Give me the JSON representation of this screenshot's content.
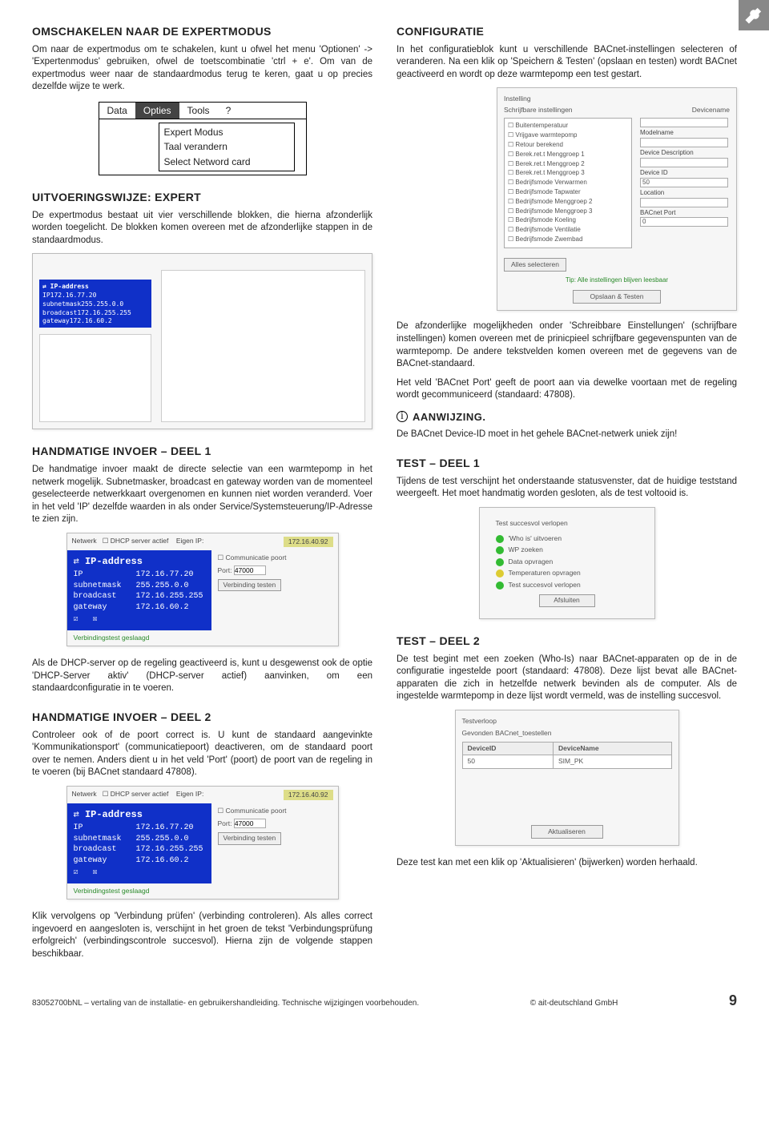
{
  "page_icon": "wrench-icon",
  "left": {
    "h_omschakelen": "OMSCHAKELEN NAAR DE EXPERTMODUS",
    "p_omschakelen_1": "Om naar de expertmodus om te schakelen, kunt u ofwel het menu 'Optionen' -> 'Expertenmodus' gebruiken, ofwel de toetscombinatie 'ctrl + e'. Om van de expertmodus weer naar de standaardmodus terug te keren, gaat u op precies dezelfde wijze te werk.",
    "menu": {
      "items": [
        "Data",
        "Opties",
        "Tools",
        "?"
      ],
      "dropdown": [
        "Expert Modus",
        "Taal verandern",
        "Select Netword card"
      ]
    },
    "h_uitvoering": "UITVOERINGSWIJZE: EXPERT",
    "p_uitvoering": "De expertmodus bestaat uit vier verschillende blokken, die hierna afzonderlijk worden toegelicht. De blokken komen overeen met de afzonderlijke stappen in de standaardmodus.",
    "ss_big_blue": {
      "title": "IP-address",
      "rows": [
        [
          "IP",
          "172.16.77.20"
        ],
        [
          "subnetmask",
          "255.255.0.0"
        ],
        [
          "broadcast",
          "172.16.255.255"
        ],
        [
          "gateway",
          "172.16.60.2"
        ]
      ]
    },
    "h_hand1": "HANDMATIGE INVOER – DEEL 1",
    "p_hand1": "De handmatige invoer maakt de directe selectie van een warmtepomp in het netwerk mogelijk. Subnetmasker, broadcast en gateway worden van de momenteel geselecteerde netwerkkaart overgenomen en kunnen niet worden veranderd. Voer in het veld 'IP' dezelfde waarden in als onder Service/Systemsteuerung/IP-Adresse te zien zijn.",
    "ss_net": {
      "group": "Netwerk",
      "dhcp": "DHCP server actief",
      "eigen": "Eigen IP:",
      "eigen_ip": "172.16.40.92",
      "comm": "Communicatie poort",
      "port_label": "Port:",
      "port_value": "47000",
      "btn_test": "Verbinding testen",
      "status": "Verbindingstest geslaagd",
      "blue": {
        "title": "IP-address",
        "rows": [
          [
            "IP",
            "172.16.77.20"
          ],
          [
            "subnetmask",
            "255.255.0.0"
          ],
          [
            "broadcast",
            "172.16.255.255"
          ],
          [
            "gateway",
            "172.16.60.2"
          ]
        ]
      }
    },
    "p_hand1_after": "Als de DHCP-server op de regeling geactiveerd is, kunt u desgewenst ook de optie 'DHCP-Server aktiv' (DHCP-server actief) aanvinken, om een standaardconfiguratie in te voeren.",
    "h_hand2": "HANDMATIGE INVOER – DEEL 2",
    "p_hand2": "Controleer ook of de poort correct is. U kunt de standaard aangevinkte 'Kommunikationsport' (communicatiepoort) deactiveren, om de standaard poort over te nemen. Anders dient u in het veld 'Port' (poort) de poort van de regeling in te voeren (bij BACnet standaard 47808).",
    "p_hand2_after": "Klik vervolgens op 'Verbindung prüfen' (verbinding controleren). Als alles correct ingevoerd en aangesloten is, verschijnt in het groen de tekst 'Verbindungsprüfung erfolgreich' (verbindingscontrole succesvol). Hierna zijn de volgende stappen beschikbaar."
  },
  "right": {
    "h_config": "CONFIGURATIE",
    "p_config": "In het configuratieblok kunt u verschillende BACnet-instellingen selecteren of veranderen. Na een klik op 'Speichern & Testen' (opslaan en testen) wordt BACnet geactiveerd en wordt op deze warmtepomp een test gestart.",
    "ss_config": {
      "title": "Instelling",
      "sub": "Schrijfbare instellingen",
      "list": [
        "Buitentemperatuur",
        "Vrijgave warmtepomp",
        "Retour berekend",
        "Berek.ret.t Menggroep 1",
        "Berek.ret.t Menggroep 2",
        "Berek.ret.t Menggroep 3",
        "Bedrijfsmode Verwarmen",
        "Bedrijfsmode Tapwater",
        "Bedrijfsmode Menggroep 2",
        "Bedrijfsmode Menggroep 3",
        "Bedrijfsmode Koeling",
        "Bedrijfsmode Ventilatie",
        "Bedrijfsmode Zwembad"
      ],
      "select_all": "Alles selecteren",
      "fields": [
        {
          "label": "Devicename",
          "val": ""
        },
        {
          "label": "Modelname",
          "val": ""
        },
        {
          "label": "Device Description",
          "val": ""
        },
        {
          "label": "Device ID",
          "val": "50"
        },
        {
          "label": "Location",
          "val": ""
        },
        {
          "label": "BACnet Port",
          "val": "0"
        }
      ],
      "tip": "Tip: Alle instellingen blijven leesbaar",
      "btn": "Opslaan & Testen"
    },
    "p_config2a": "De afzonderlijke mogelijkheden onder 'Schreibbare Einstellungen' (schrijfbare instellingen) komen overeen met de prinicpieel schrijfbare gegevenspunten van de warmtepomp. De andere tekstvelden komen overeen met de gegevens van de BACnet-standaard.",
    "p_config2b": "Het veld 'BACnet Port' geeft de poort aan via dewelke voortaan met de regeling wordt gecommuniceerd (standaard: 47808).",
    "hint_label": "AANWIJZING.",
    "p_hint": "De BACnet Device-ID moet in het gehele BACnet-netwerk uniek zijn!",
    "h_test1": "TEST – DEEL 1",
    "p_test1": "Tijdens de test verschijnt het onderstaande statusvenster, dat de huidige teststand weergeeft. Het moet handmatig worden gesloten, als de test voltooid is.",
    "ss_test": {
      "head": "Test succesvol verlopen",
      "rows": [
        {
          "color": "g",
          "label": "'Who is' uitvoeren"
        },
        {
          "color": "g",
          "label": "WP zoeken"
        },
        {
          "color": "g",
          "label": "Data opvragen"
        },
        {
          "color": "y",
          "label": "Temperaturen opvragen"
        },
        {
          "color": "g",
          "label": "Test succesvol verlopen"
        }
      ],
      "btn": "Afsluiten"
    },
    "h_test2": "TEST – DEEL 2",
    "p_test2": "De test begint met een zoeken (Who-Is) naar BACnet-apparaten op de in de configuratie ingestelde poort (standaard: 47808). Deze lijst bevat alle BACnet-apparaten die zich in hetzelfde netwerk bevinden als de computer. Als de ingestelde warmtepomp in deze lijst wordt vermeld, was de instelling succesvol.",
    "ss_table": {
      "cap1": "Testverloop",
      "cap2": "Gevonden BACnet_toestellen",
      "cols": [
        "DeviceID",
        "DeviceName"
      ],
      "rows": [
        [
          "50",
          "SIM_PK"
        ]
      ],
      "btn": "Aktualiseren"
    },
    "p_test2_after": "Deze test kan met een klik op 'Aktualisieren' (bijwerken) worden herhaald."
  },
  "footer": {
    "left": "83052700bNL – vertaling van de installatie- en gebruikershandleiding. Technische wijzigingen voorbehouden.",
    "mid": "© ait-deutschland GmbH",
    "page": "9"
  }
}
